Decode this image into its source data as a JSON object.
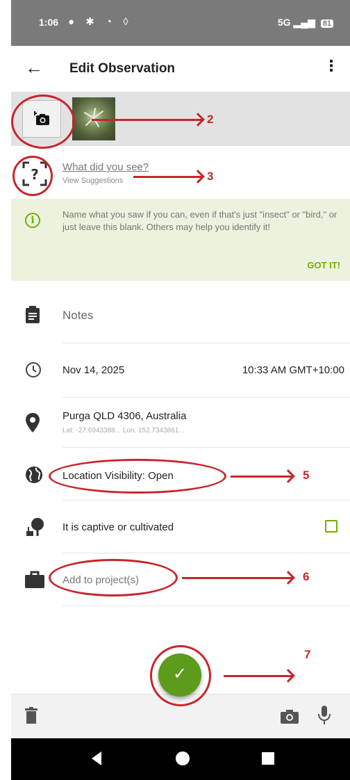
{
  "status_bar": {
    "time": "1:06",
    "network": "5G",
    "battery": "81"
  },
  "app_bar": {
    "title": "Edit Observation",
    "back_icon": "arrow-left-icon",
    "menu_icon": "more-vert-icon"
  },
  "species": {
    "prompt": "What did you see?",
    "suggestions": "View Suggestions"
  },
  "tip": {
    "text": "Name what you saw if you can, even if that's just \"insect\" or \"bird,\" or just leave this blank. Others may help you identify it!",
    "action": "GOT IT!"
  },
  "fields": {
    "notes": "Notes",
    "date": "Nov 14, 2025",
    "time": "10:33 AM GMT+10:00",
    "location": "Purga QLD 4306, Australia",
    "coords": "Lat: -27.6943388...  Lon: 152.7343861...",
    "visibility": "Location Visibility: Open",
    "captive": "It is captive or cultivated",
    "captive_checked": false,
    "project": "Add to project(s)"
  },
  "annotations": {
    "n2": "2",
    "n3": "3",
    "n5": "5",
    "n6": "6",
    "n7": "7"
  },
  "colors": {
    "accent": "#74ac00",
    "annotation": "#c8252c",
    "fab": "#5d9b1c"
  }
}
